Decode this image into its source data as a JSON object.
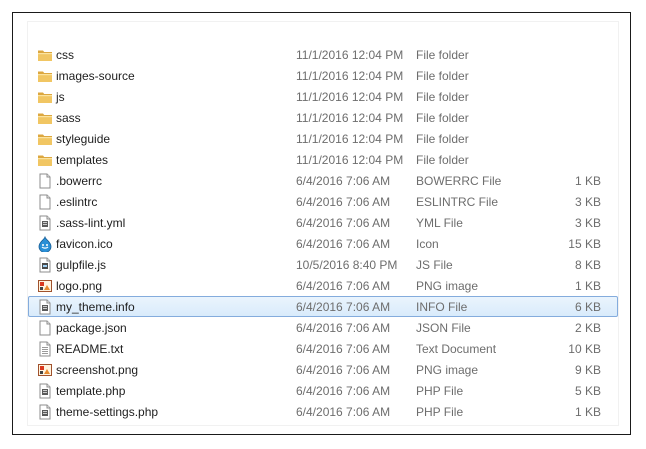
{
  "files": [
    {
      "name": "css",
      "date": "11/1/2016 12:04 PM",
      "type": "File folder",
      "size": "",
      "icon": "folder-icon"
    },
    {
      "name": "images-source",
      "date": "11/1/2016 12:04 PM",
      "type": "File folder",
      "size": "",
      "icon": "folder-icon"
    },
    {
      "name": "js",
      "date": "11/1/2016 12:04 PM",
      "type": "File folder",
      "size": "",
      "icon": "folder-icon"
    },
    {
      "name": "sass",
      "date": "11/1/2016 12:04 PM",
      "type": "File folder",
      "size": "",
      "icon": "folder-icon"
    },
    {
      "name": "styleguide",
      "date": "11/1/2016 12:04 PM",
      "type": "File folder",
      "size": "",
      "icon": "folder-icon"
    },
    {
      "name": "templates",
      "date": "11/1/2016 12:04 PM",
      "type": "File folder",
      "size": "",
      "icon": "folder-icon"
    },
    {
      "name": ".bowerrc",
      "date": "6/4/2016 7:06 AM",
      "type": "BOWERRC File",
      "size": "1 KB",
      "icon": "blank-file-icon"
    },
    {
      "name": ".eslintrc",
      "date": "6/4/2016 7:06 AM",
      "type": "ESLINTRC File",
      "size": "3 KB",
      "icon": "blank-file-icon"
    },
    {
      "name": ".sass-lint.yml",
      "date": "6/4/2016 7:06 AM",
      "type": "YML File",
      "size": "3 KB",
      "icon": "document-file-icon"
    },
    {
      "name": "favicon.ico",
      "date": "6/4/2016 7:06 AM",
      "type": "Icon",
      "size": "15 KB",
      "icon": "drupal-drop-icon"
    },
    {
      "name": "gulpfile.js",
      "date": "10/5/2016 8:40 PM",
      "type": "JS File",
      "size": "8 KB",
      "icon": "script-file-icon"
    },
    {
      "name": "logo.png",
      "date": "6/4/2016 7:06 AM",
      "type": "PNG image",
      "size": "1 KB",
      "icon": "image-file-icon"
    },
    {
      "name": "my_theme.info",
      "date": "6/4/2016 7:06 AM",
      "type": "INFO File",
      "size": "6 KB",
      "icon": "document-file-icon",
      "selected": true
    },
    {
      "name": "package.json",
      "date": "6/4/2016 7:06 AM",
      "type": "JSON File",
      "size": "2 KB",
      "icon": "blank-file-icon"
    },
    {
      "name": "README.txt",
      "date": "6/4/2016 7:06 AM",
      "type": "Text Document",
      "size": "10 KB",
      "icon": "text-file-icon"
    },
    {
      "name": "screenshot.png",
      "date": "6/4/2016 7:06 AM",
      "type": "PNG image",
      "size": "9 KB",
      "icon": "image-file-icon"
    },
    {
      "name": "template.php",
      "date": "6/4/2016 7:06 AM",
      "type": "PHP File",
      "size": "5 KB",
      "icon": "document-file-icon"
    },
    {
      "name": "theme-settings.php",
      "date": "6/4/2016 7:06 AM",
      "type": "PHP File",
      "size": "1 KB",
      "icon": "document-file-icon"
    }
  ],
  "colors": {
    "selection_fill": "#d9ebfb",
    "selection_border": "#84acdd",
    "folder": "#e8b64a",
    "secondary_text": "#6d6d6d"
  }
}
